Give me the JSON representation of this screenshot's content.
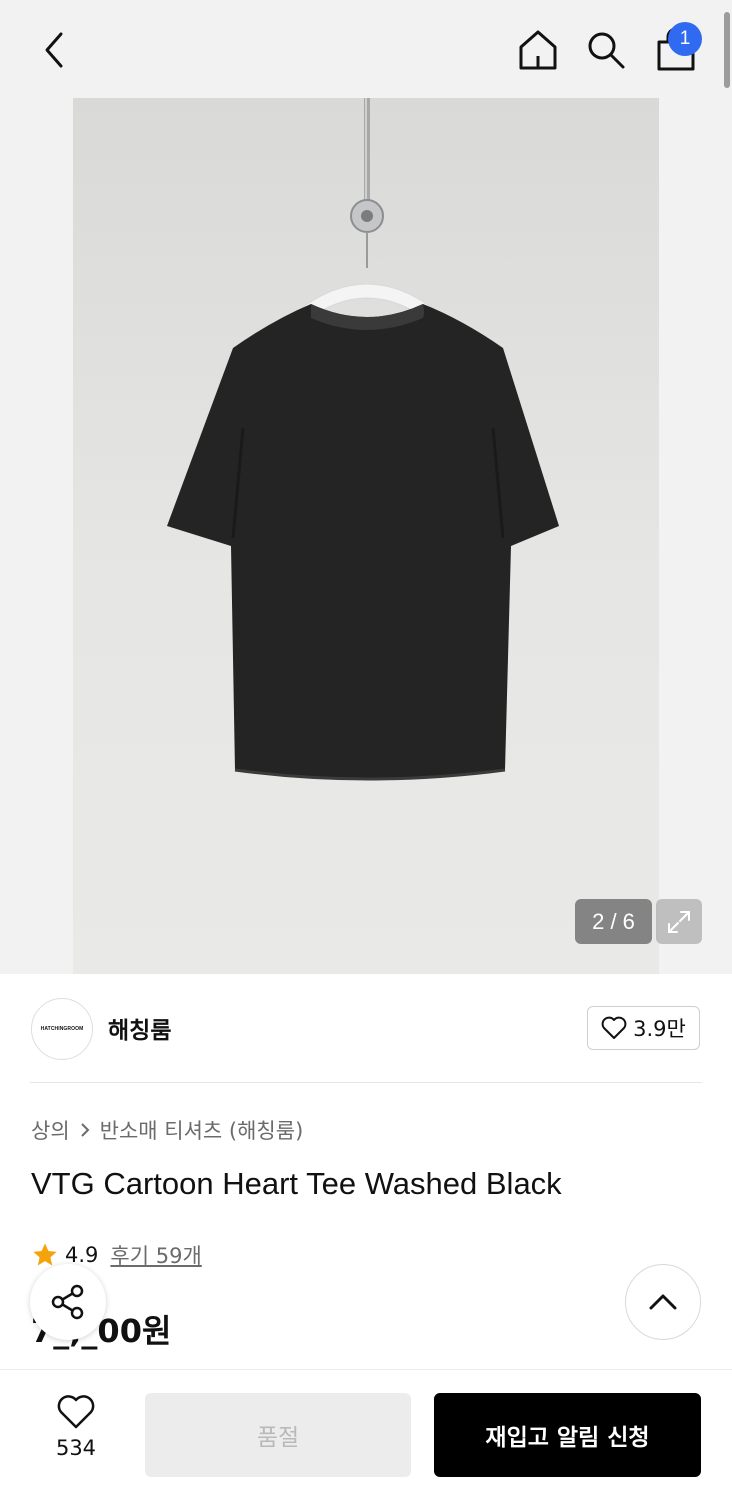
{
  "header": {
    "cart_count": "1"
  },
  "gallery": {
    "counter": "2 / 6"
  },
  "brand": {
    "logo_text": "HATCHINGROOM",
    "name": "해칭룸",
    "likes": "3.9만"
  },
  "breadcrumb": {
    "category": "상의",
    "subcategory": "반소매 티셔츠 (해칭룸)"
  },
  "product": {
    "title": "VTG Cartoon Heart Tee Washed Black",
    "rating": "4.9",
    "reviews": "후기 59개",
    "price": "7_,_00원"
  },
  "bottom_bar": {
    "wish_count": "534",
    "soldout_label": "품절",
    "restock_label": "재입고 알림 신청"
  },
  "colors": {
    "accent_badge": "#2f6af0",
    "star": "#f5a30a",
    "primary_button": "#000000"
  }
}
